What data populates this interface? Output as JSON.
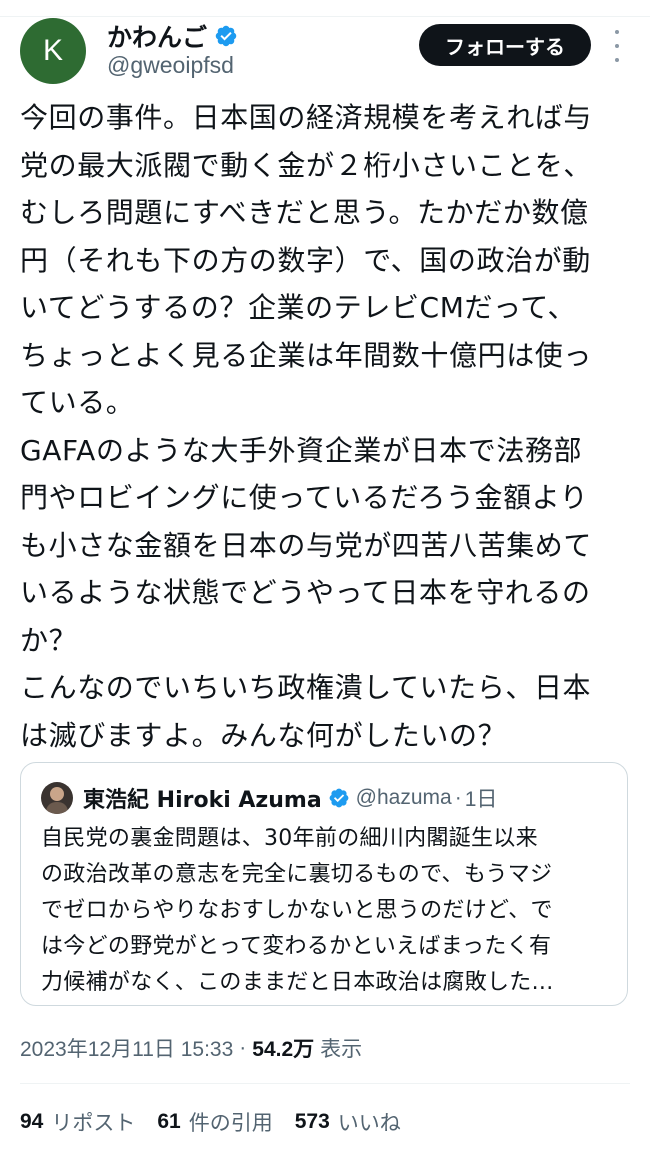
{
  "author": {
    "avatar_letter": "K",
    "display_name": "かわんご",
    "handle": "@gweoipfsd",
    "verified": true
  },
  "follow_label": "フォローする",
  "tweet_lines": [
    "今回の事件。日本国の経済規模を考えれば与",
    "党の最大派閥で動く金が２桁小さいことを、",
    "むしろ問題にすべきだと思う。たかだか数億",
    "円（それも下の方の数字）で、国の政治が動",
    "いてどうするの？企業のテレビCMだって、",
    "ちょっとよく見る企業は年間数十億円は使っ",
    "ている。",
    "GAFAのような大手外資企業が日本で法務部",
    "門やロビイングに使っているだろう金額より",
    "も小さな金額を日本の与党が四苦八苦集めて",
    "いるような状態でどうやって日本を守れるの",
    "か？",
    "こんなのでいちいち政権潰していたら、日本",
    "は滅びますよ。みんな何がしたいの？"
  ],
  "quote": {
    "name": "東浩紀 Hiroki Azuma",
    "handle": "@hazuma",
    "separator": "·",
    "time": "1日",
    "verified": true,
    "lines": [
      "自民党の裏金問題は、30年前の細川内閣誕生以来",
      "の政治改革の意志を完全に裏切るもので、もうマジ",
      "でゼロからやりなおすしかないと思うのだけど、で",
      "は今どの野党がとって変わるかといえばまったく有",
      "力候補がなく、このままだと日本政治は腐敗した..."
    ]
  },
  "meta": {
    "datetime": "2023年12月11日 15:33",
    "separator": "·",
    "views": "54.2万",
    "views_label": "表示"
  },
  "stats": {
    "reposts": {
      "count": "94",
      "label": "リポスト"
    },
    "quotes": {
      "count": "61",
      "label": "件の引用"
    },
    "likes": {
      "count": "573",
      "label": "いいね"
    }
  },
  "colors": {
    "avatar_bg": "#2e6b32",
    "verified": "#1d9bf0",
    "follow_bg": "#0f1419",
    "secondary_text": "#536471"
  },
  "icons": {
    "verified": "verified-badge-icon",
    "more": "more-options-icon"
  }
}
